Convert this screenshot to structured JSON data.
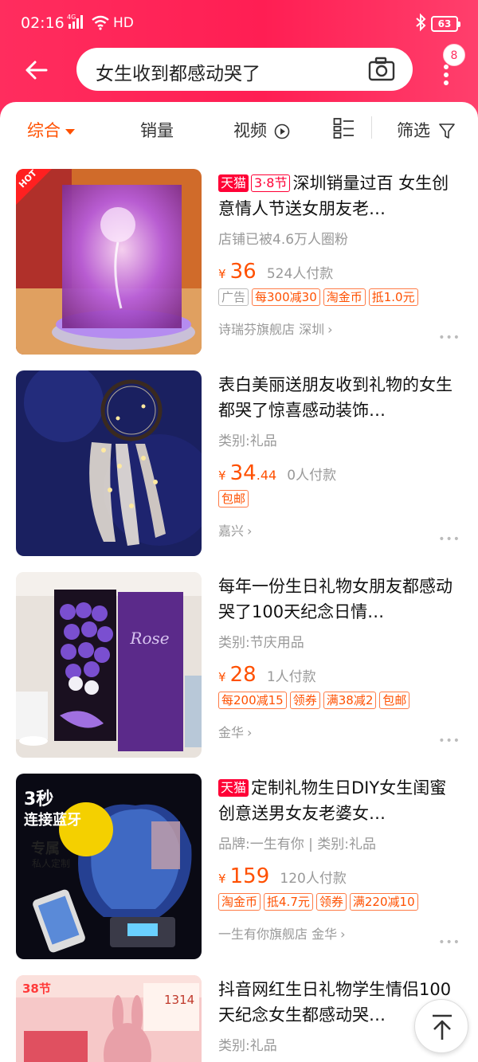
{
  "status_bar": {
    "time": "02:16",
    "network": "4G",
    "hd": "HD",
    "battery": "63"
  },
  "header": {
    "search_query": "女生收到都感动哭了",
    "message_badge": "8"
  },
  "sort_bar": {
    "items": [
      {
        "label": "综合",
        "active": true
      },
      {
        "label": "销量",
        "active": false
      },
      {
        "label": "视频",
        "active": false
      },
      {
        "label": "筛选",
        "active": false
      }
    ]
  },
  "products": [
    {
      "tags": [
        "天猫",
        "3·8节"
      ],
      "title": "深圳销量过百 女生创意情人节送女朋友老…",
      "subtitle": "店铺已被4.6万人圈粉",
      "price_int": "36",
      "price_dec": "",
      "paid": "524人付款",
      "chips": [
        {
          "text": "广告",
          "grey": true
        },
        {
          "text": "每300减30",
          "grey": false
        },
        {
          "text": "淘金币",
          "grey": false
        },
        {
          "text": "抵1.0元",
          "grey": false
        }
      ],
      "shop": "诗瑞芬旗舰店 深圳",
      "thumb_badge": "HOT"
    },
    {
      "tags": [],
      "title": "表白美丽送朋友收到礼物的女生都哭了惊喜感动装饰…",
      "subtitle": "类别:礼品",
      "price_int": "34",
      "price_dec": ".44",
      "paid": "0人付款",
      "chips": [
        {
          "text": "包邮",
          "grey": false
        }
      ],
      "shop": "嘉兴"
    },
    {
      "tags": [],
      "title": "每年一份生日礼物女朋友都感动哭了100天纪念日情…",
      "subtitle": "类别:节庆用品",
      "price_int": "28",
      "price_dec": "",
      "paid": "1人付款",
      "chips": [
        {
          "text": "每200减15",
          "grey": false
        },
        {
          "text": "领券",
          "grey": false
        },
        {
          "text": "满38减2",
          "grey": false
        },
        {
          "text": "包邮",
          "grey": false
        }
      ],
      "shop": "金华"
    },
    {
      "tags": [
        "天猫"
      ],
      "title": "定制礼物生日DIY女生闺蜜创意送男女友老婆女…",
      "subtitle": "品牌:一生有你 | 类别:礼品",
      "price_int": "159",
      "price_dec": "",
      "paid": "120人付款",
      "chips": [
        {
          "text": "淘金币",
          "grey": false
        },
        {
          "text": "抵4.7元",
          "grey": false
        },
        {
          "text": "领券",
          "grey": false
        },
        {
          "text": "满220减10",
          "grey": false
        }
      ],
      "shop": "一生有你旗舰店 金华",
      "thumb_texts": {
        "line1": "3秒",
        "line2": "连接蓝牙",
        "exclusive": "专属",
        "custom": "私人定制"
      }
    },
    {
      "tags": [],
      "title": "抖音网红生日礼物学生情侣100天纪念女生都感动哭…",
      "subtitle": "类别:礼品",
      "thumb_badge": "38节",
      "thumb_number": "1314"
    }
  ],
  "colors": {
    "header": "#ff2d5e",
    "price": "#ff5000",
    "tmall": "#ff0036"
  }
}
